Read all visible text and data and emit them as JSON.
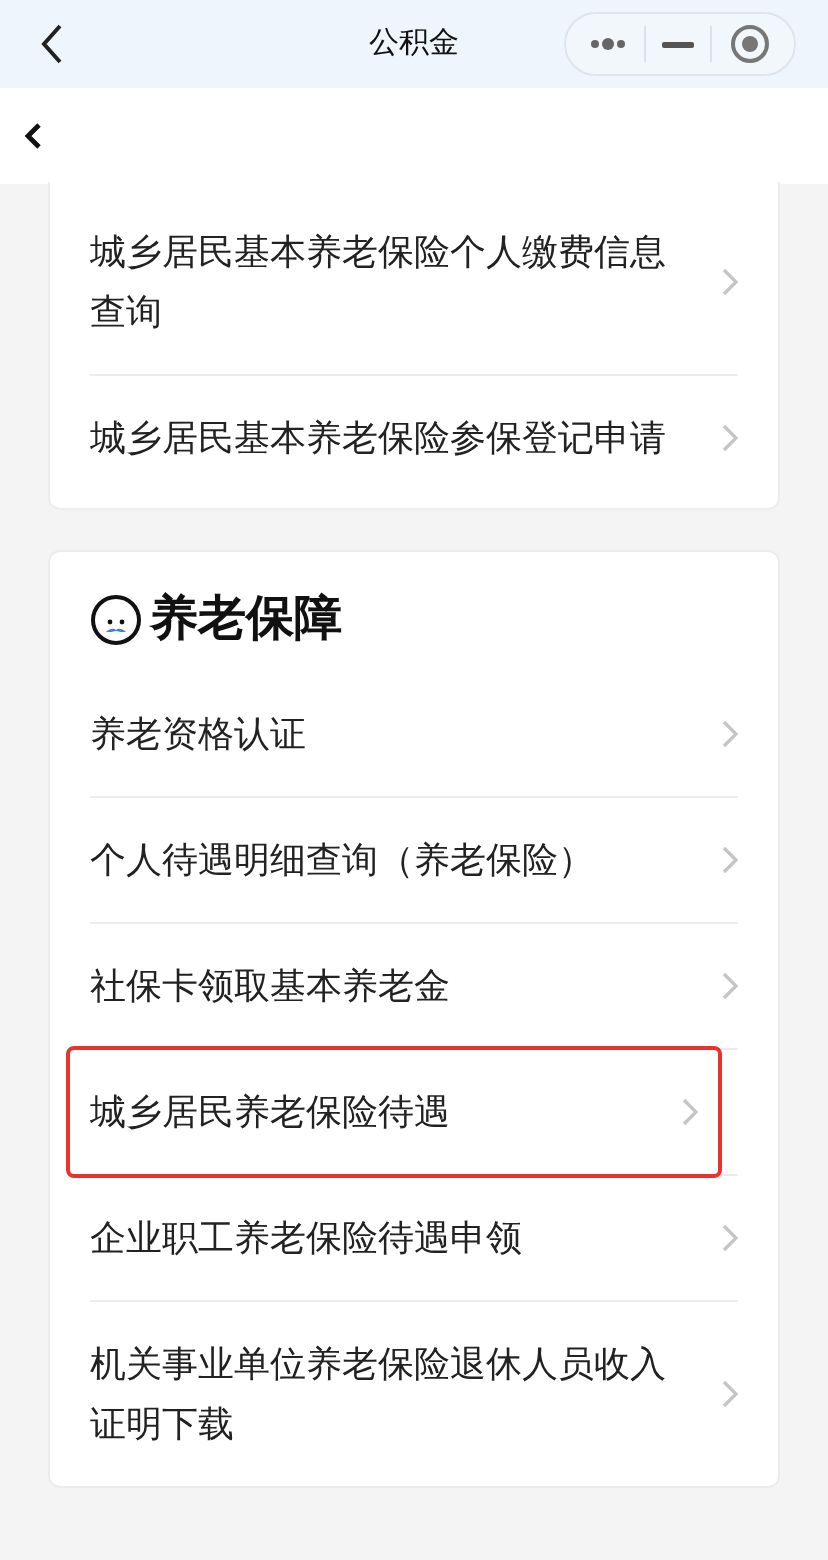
{
  "top_bar": {
    "title": "公积金"
  },
  "card_1": {
    "items": [
      {
        "label": "城乡居民基本养老保险个人缴费信息查询",
        "highlighted": false
      },
      {
        "label": "城乡居民基本养老保险参保登记申请",
        "highlighted": false
      }
    ]
  },
  "card_2": {
    "title": "养老保障",
    "items": [
      {
        "label": "养老资格认证",
        "highlighted": false
      },
      {
        "label": "个人待遇明细查询（养老保险）",
        "highlighted": false
      },
      {
        "label": "社保卡领取基本养老金",
        "highlighted": false
      },
      {
        "label": "城乡居民养老保险待遇",
        "highlighted": true
      },
      {
        "label": "企业职工养老保险待遇申领",
        "highlighted": false
      },
      {
        "label": "机关事业单位养老保险退休人员收入证明下载",
        "highlighted": false
      }
    ]
  }
}
